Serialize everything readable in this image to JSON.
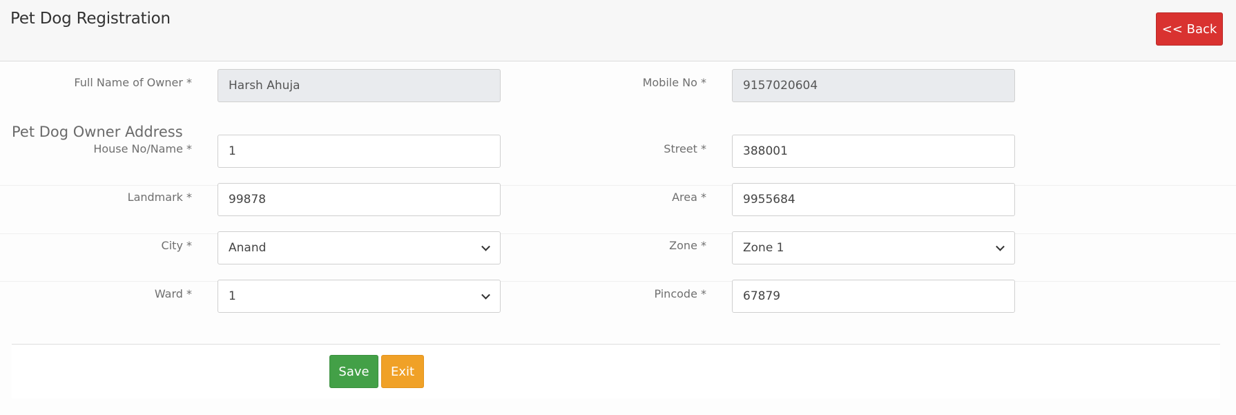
{
  "header": {
    "title": "Pet Dog Registration",
    "back_label": "<< Back"
  },
  "owner": {
    "name_label": "Full Name of Owner *",
    "name_value": "Harsh Ahuja",
    "mobile_label": "Mobile No *",
    "mobile_value": "9157020604"
  },
  "address": {
    "heading": "Pet Dog Owner Address",
    "house_label": "House No/Name *",
    "house_value": "1",
    "street_label": "Street *",
    "street_value": "388001",
    "landmark_label": "Landmark *",
    "landmark_value": "99878",
    "area_label": "Area *",
    "area_value": "9955684",
    "city_label": "City *",
    "city_value": "Anand",
    "zone_label": "Zone *",
    "zone_value": "Zone 1",
    "ward_label": "Ward *",
    "ward_value": "1",
    "pincode_label": "Pincode *",
    "pincode_value": "67879"
  },
  "actions": {
    "save_label": "Save",
    "exit_label": "Exit"
  },
  "colors": {
    "back_button": "#d93230",
    "save_button": "#43a047",
    "exit_button": "#f0a127",
    "readonly_field": "#e9ebee"
  },
  "icons": {
    "select_arrow": "chevron-down-icon"
  }
}
